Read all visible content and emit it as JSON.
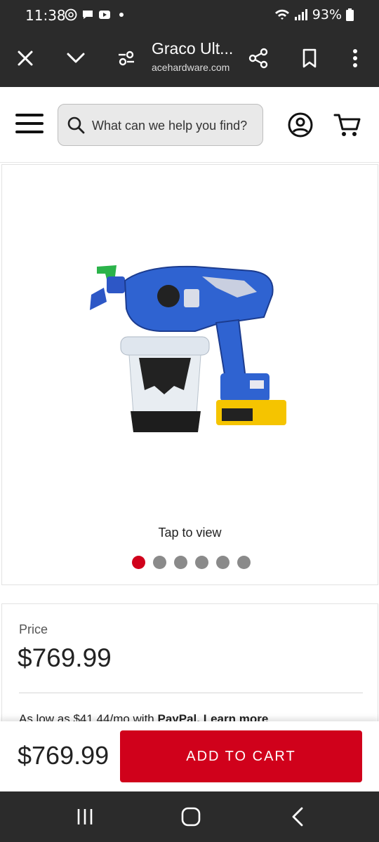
{
  "status_bar": {
    "time": "11:38",
    "battery": "93%"
  },
  "browser": {
    "title": "Graco Ult...",
    "url": "acehardware.com"
  },
  "search": {
    "placeholder": "What can we help you find?"
  },
  "gallery": {
    "tap_label": "Tap to view",
    "dot_count": 6,
    "active_index": 0
  },
  "product": {
    "price_label": "Price",
    "price": "$769.99"
  },
  "paypal": {
    "prefix": "As low as $41.44/mo with ",
    "brand": "PayPal.",
    "link": "Learn more"
  },
  "sticky": {
    "price": "$769.99",
    "add_to_cart": "ADD TO CART"
  },
  "colors": {
    "accent": "#d0011b",
    "chrome": "#2b2b2b"
  }
}
